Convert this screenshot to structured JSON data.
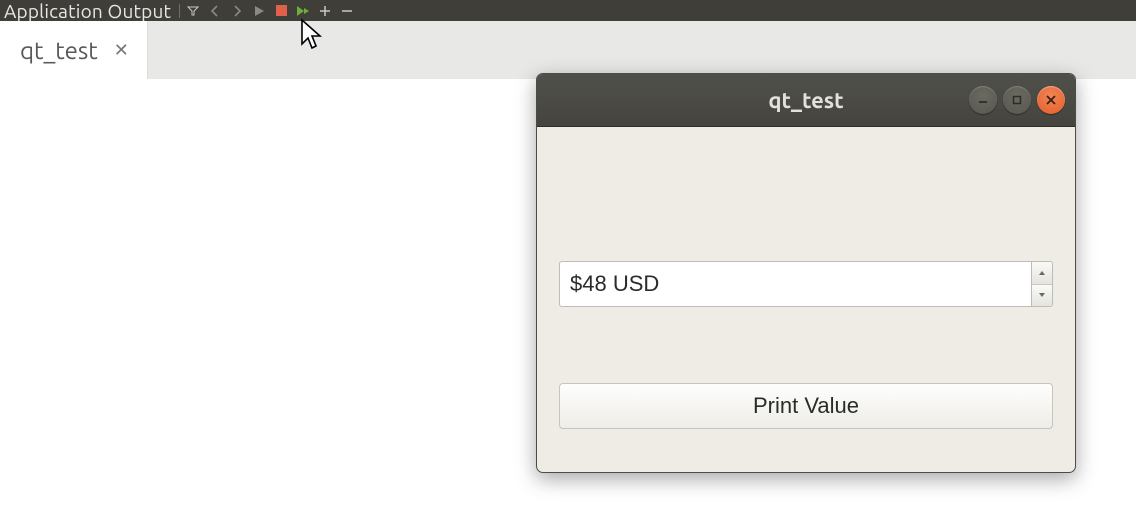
{
  "ide": {
    "panel_title": "Application Output",
    "tab": {
      "label": "qt_test"
    }
  },
  "qt_window": {
    "title": "qt_test",
    "spinbox_value": "$48 USD",
    "button_label": "Print Value"
  }
}
